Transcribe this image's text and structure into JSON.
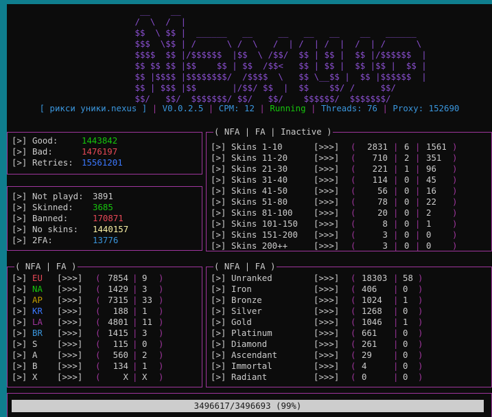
{
  "banner": {
    "art": "                          __    __\n                         /  \\  /  |\n                         $$  \\ $$ |  ______   __     __   __   __    __   ______\n                         $$$  \\$$ | /      \\ /  \\   /  | /  | /  |  /  | /      \\\n                         $$$$  $$ |/$$$$$$  |$$  \\ /$$/  $$ | $$ |  $$ |/$$$$$$  |\n                         $$ $$ $$ |$$    $$ | $$  /$$<   $$ | $$ |  $$ |$$ |  $$ |\n                         $$ |$$$$ |$$$$$$$$/  /$$$$  \\   $$ \\__$$ |  $$ |$$$$$$  |\n                         $$ | $$$ |$$       |/$$/ $$  |  $$    $$/ /     $$/\n                         $$/   $$/  $$$$$$$/ $$/   $$/    $$$$$$/  $$$$$$$/"
  },
  "status": {
    "br_open": "[ ",
    "name": "рикси уники.nexus",
    "br_close": " ]",
    "version": "V0.0.2.5",
    "cpm": "CPM: 12",
    "state": "Running",
    "threads": "Threads: 76",
    "proxy": "Proxy: 152690",
    "divider": " | "
  },
  "common": {
    "bullet": "[>]",
    "arrows": "[>>>]",
    "open": "(",
    "close": ")",
    "bar": "|"
  },
  "counts": [
    {
      "label": "Good:",
      "value": "1443842",
      "color": "#16c60c"
    },
    {
      "label": "Bad:",
      "value": "1476197",
      "color": "#e74856"
    },
    {
      "label": "Retries:",
      "value": "15561201",
      "color": "#3b78ff"
    }
  ],
  "details": [
    {
      "label": "Not playd:",
      "value": "3891",
      "color": "#cccccc"
    },
    {
      "label": "Skinned:",
      "value": "3685",
      "color": "#16c60c"
    },
    {
      "label": "Banned:",
      "value": "170871",
      "color": "#e74856"
    },
    {
      "label": "No skins:",
      "value": "1440157",
      "color": "#f9f1a5"
    },
    {
      "label": "2FA:",
      "value": "13776",
      "color": "#3a96dd"
    }
  ],
  "skins": {
    "title": "( NFA | FA | Inactive )",
    "rows": [
      {
        "label": "Skins 1-10",
        "nfa": "2831",
        "fa": "6",
        "inactive": "1561"
      },
      {
        "label": "Skins 11-20",
        "nfa": "710",
        "fa": "2",
        "inactive": "351"
      },
      {
        "label": "Skins 21-30",
        "nfa": "221",
        "fa": "1",
        "inactive": "96"
      },
      {
        "label": "Skins 31-40",
        "nfa": "114",
        "fa": "0",
        "inactive": "45"
      },
      {
        "label": "Skins 41-50",
        "nfa": "56",
        "fa": "0",
        "inactive": "16"
      },
      {
        "label": "Skins 51-80",
        "nfa": "78",
        "fa": "0",
        "inactive": "22"
      },
      {
        "label": "Skins 81-100",
        "nfa": "20",
        "fa": "0",
        "inactive": "2"
      },
      {
        "label": "Skins 101-150",
        "nfa": "8",
        "fa": "0",
        "inactive": "1"
      },
      {
        "label": "Skins 151-200",
        "nfa": "3",
        "fa": "0",
        "inactive": "0"
      },
      {
        "label": "Skins 200++",
        "nfa": "3",
        "fa": "0",
        "inactive": "0"
      }
    ]
  },
  "regions": {
    "title": "( NFA | FA )",
    "rows": [
      {
        "label": "EU",
        "color": "#e74856",
        "nfa": "7854",
        "fa": "9"
      },
      {
        "label": "NA",
        "color": "#16c60c",
        "nfa": "1429",
        "fa": "3"
      },
      {
        "label": "AP",
        "color": "#c19c00",
        "nfa": "7315",
        "fa": "33"
      },
      {
        "label": "KR",
        "color": "#3b78ff",
        "nfa": "188",
        "fa": "1"
      },
      {
        "label": "LA",
        "color": "#a0369e",
        "nfa": "4801",
        "fa": "11"
      },
      {
        "label": "BR",
        "color": "#3a96dd",
        "nfa": "1415",
        "fa": "3"
      },
      {
        "label": "S",
        "color": "#cccccc",
        "nfa": "115",
        "fa": "0"
      },
      {
        "label": "A",
        "color": "#cccccc",
        "nfa": "560",
        "fa": "2"
      },
      {
        "label": "B",
        "color": "#cccccc",
        "nfa": "134",
        "fa": "1"
      },
      {
        "label": "X",
        "color": "#cccccc",
        "nfa": "X",
        "fa": "X"
      }
    ]
  },
  "ranks": {
    "title": "( NFA | FA )",
    "rows": [
      {
        "label": "Unranked",
        "nfa": "18303",
        "fa": "58"
      },
      {
        "label": "Iron",
        "nfa": "406",
        "fa": "0"
      },
      {
        "label": "Bronze",
        "nfa": "1024",
        "fa": "1"
      },
      {
        "label": "Silver",
        "nfa": "1268",
        "fa": "0"
      },
      {
        "label": "Gold",
        "nfa": "1046",
        "fa": "1"
      },
      {
        "label": "Platinum",
        "nfa": "661",
        "fa": "0"
      },
      {
        "label": "Diamond",
        "nfa": "261",
        "fa": "0"
      },
      {
        "label": "Ascendant",
        "nfa": "29",
        "fa": "0"
      },
      {
        "label": "Immortal",
        "nfa": "4",
        "fa": "0"
      },
      {
        "label": "Radiant",
        "nfa": "0",
        "fa": "0"
      }
    ]
  },
  "progress": {
    "text": "3496617/3496693 (99%)",
    "fraction": 0.99998
  },
  "colors": {
    "accent": "#a0369e",
    "banner": "#8a4fd0",
    "info": "#3a96dd",
    "running": "#16c60c",
    "label": "#cccccc"
  }
}
